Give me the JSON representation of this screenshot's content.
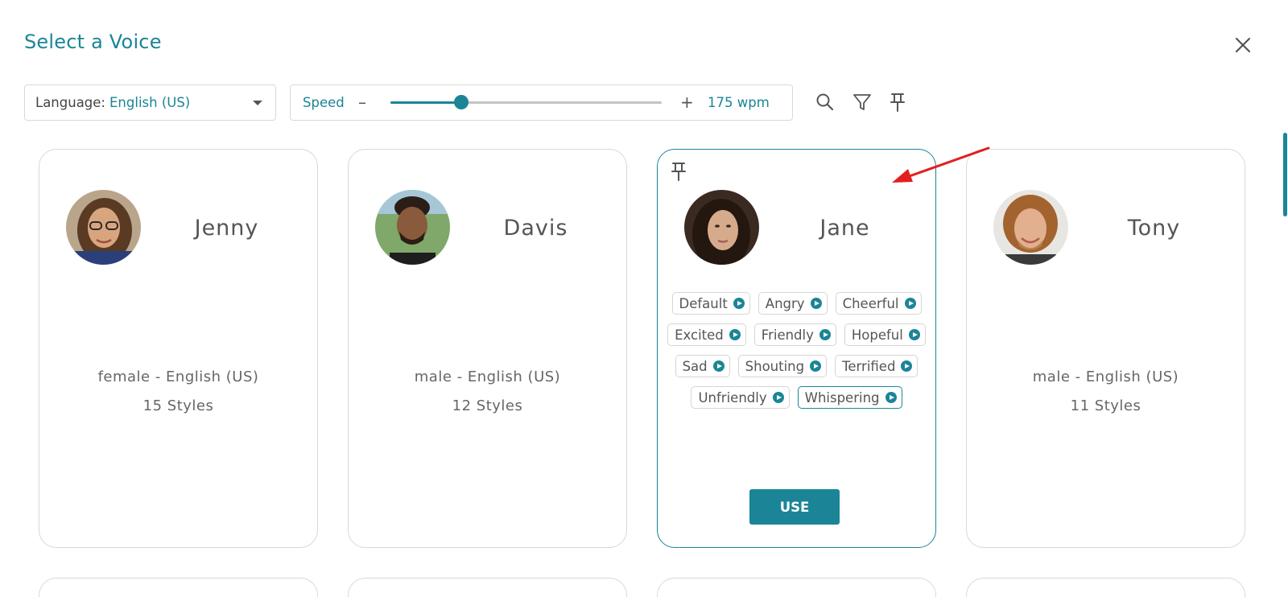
{
  "dialog": {
    "title": "Select a Voice",
    "close_icon": "close-icon"
  },
  "toolbar": {
    "language_label": "Language:",
    "language_value": "English (US)",
    "speed_label": "Speed",
    "speed_minus": "–",
    "speed_plus": "+",
    "speed_value": "175 wpm",
    "speed_slider_fraction": 0.26,
    "icons": [
      "search-icon",
      "filter-icon",
      "pin-icon"
    ]
  },
  "colors": {
    "accent": "#1b8597",
    "card_border": "#d8d8d8",
    "arrow": "#e02020"
  },
  "voices": [
    {
      "name": "Jenny",
      "description": "female - English (US)",
      "styles_count": "15 Styles"
    },
    {
      "name": "Davis",
      "description": "male - English (US)",
      "styles_count": "12 Styles"
    },
    {
      "name": "Jane",
      "selected": true,
      "pinned": true,
      "styles": [
        "Default",
        "Angry",
        "Cheerful",
        "Excited",
        "Friendly",
        "Hopeful",
        "Sad",
        "Shouting",
        "Terrified",
        "Unfriendly",
        "Whispering"
      ],
      "active_style": "Whispering",
      "use_label": "USE"
    },
    {
      "name": "Tony",
      "description": "male - English (US)",
      "styles_count": "11 Styles"
    }
  ]
}
